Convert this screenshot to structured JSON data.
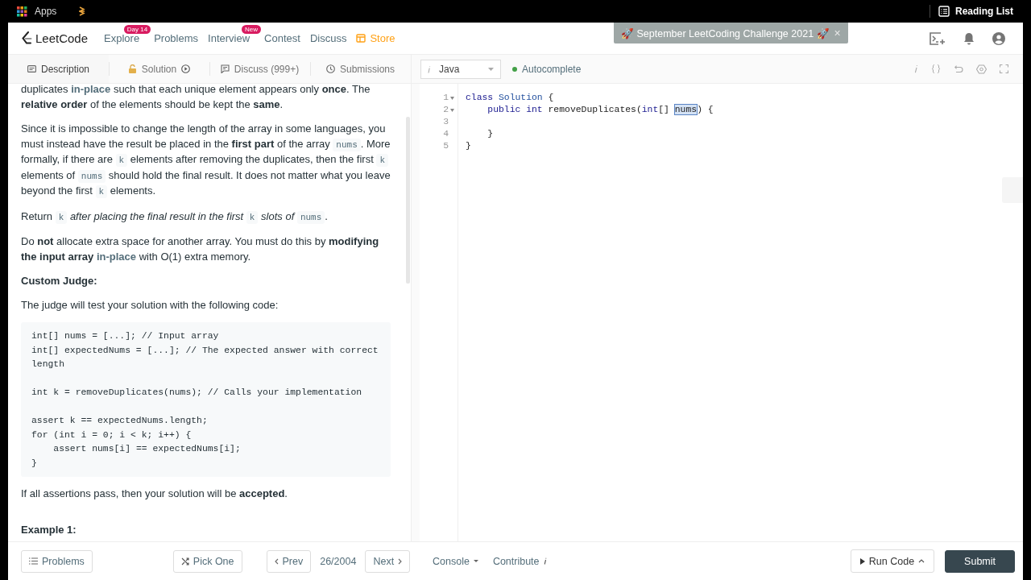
{
  "browser_bar": {
    "apps_label": "Apps",
    "reading_list": "Reading List"
  },
  "nav": {
    "logo": "LeetCode",
    "items": [
      {
        "label": "Explore",
        "badge": "Day 14",
        "kind": "link"
      },
      {
        "label": "Problems",
        "kind": "link"
      },
      {
        "label": "Interview",
        "badge": "New",
        "kind": "link"
      },
      {
        "label": "Contest",
        "kind": "link"
      },
      {
        "label": "Discuss",
        "kind": "link"
      },
      {
        "label": "Store",
        "kind": "store"
      }
    ]
  },
  "banner": {
    "text": "🚀 September LeetCoding Challenge 2021 🚀",
    "close": "×"
  },
  "panel_tabs": [
    {
      "label": "Description",
      "selected": true
    },
    {
      "label": "Solution",
      "selected": false
    },
    {
      "label": "Discuss (999+)",
      "selected": false
    },
    {
      "label": "Submissions",
      "selected": false
    }
  ],
  "editor_toolbar": {
    "language": "Java",
    "autocomplete": {
      "label": "Autocomplete",
      "on": true
    }
  },
  "description": {
    "blocks": [
      {
        "kind": "paragraph",
        "segments": [
          {
            "kind": "text",
            "text": "duplicates "
          },
          {
            "kind": "accent",
            "text": "in-place"
          },
          {
            "kind": "text",
            "text": " such that each unique element appears only **once**. The **relative order** of the elements should be kept the **same**."
          }
        ]
      },
      {
        "kind": "paragraph",
        "segments": [
          {
            "kind": "text",
            "text": "Since it is impossible to change the length of the array in some languages, you must instead have the result be placed in the **first part** of the array "
          },
          {
            "kind": "code",
            "text": "nums"
          },
          {
            "kind": "text",
            "text": ". More formally, if there are "
          },
          {
            "kind": "code",
            "text": "k"
          },
          {
            "kind": "text",
            "text": " elements after removing the duplicates, then the first "
          },
          {
            "kind": "code",
            "text": "k"
          },
          {
            "kind": "text",
            "text": " elements of "
          },
          {
            "kind": "code",
            "text": "nums"
          },
          {
            "kind": "text",
            "text": " should hold the final result. It does not matter what you leave beyond the first "
          },
          {
            "kind": "code",
            "text": "k"
          },
          {
            "kind": "text",
            "text": " elements."
          }
        ]
      },
      {
        "kind": "paragraph",
        "segments": [
          {
            "kind": "text",
            "text": "Return "
          },
          {
            "kind": "code",
            "text": "k"
          },
          {
            "kind": "text",
            "text": " *after placing the final result in the first* "
          },
          {
            "kind": "code",
            "text": "k"
          },
          {
            "kind": "text",
            "text": " *slots of* "
          },
          {
            "kind": "code",
            "text": "nums"
          },
          {
            "kind": "text",
            "text": "."
          }
        ]
      },
      {
        "kind": "paragraph",
        "segments": [
          {
            "kind": "text",
            "text": "Do **not** allocate extra space for another array. You must do this by **modifying the input array** "
          },
          {
            "kind": "accent",
            "text": "in-place"
          },
          {
            "kind": "text",
            "text": " with O(1) extra memory."
          }
        ]
      },
      {
        "kind": "heading",
        "text": "Custom Judge:"
      },
      {
        "kind": "paragraph",
        "segments": [
          {
            "kind": "text",
            "text": "The judge will test your solution with the following code:"
          }
        ]
      },
      {
        "kind": "code",
        "groups": [
          [
            "int[] nums = [...]; // Input array",
            "int[] expectedNums = [...]; // The expected answer with correct length"
          ],
          [
            "int k = removeDuplicates(nums); // Calls your implementation"
          ],
          [
            "assert k == expectedNums.length;",
            "for (int i = 0; i < k; i++) {",
            "    assert nums[i] == expectedNums[i];",
            "}"
          ]
        ]
      },
      {
        "kind": "paragraph",
        "segments": [
          {
            "kind": "text",
            "text": "If all assertions pass, then your solution will be **accepted**."
          }
        ]
      },
      {
        "kind": "heading",
        "text": "Example 1:"
      }
    ]
  },
  "editor": {
    "lines": [
      {
        "number": "1",
        "foldable": true,
        "segments": [
          {
            "kind": "keyword",
            "text": "class "
          },
          {
            "kind": "type",
            "text": "Solution"
          },
          {
            "kind": "plain",
            "text": " {"
          }
        ]
      },
      {
        "number": "2",
        "foldable": true,
        "segments": [
          {
            "kind": "keyword",
            "text": "    public int"
          },
          {
            "kind": "plain",
            "text": " removeDuplicates("
          },
          {
            "kind": "keyword",
            "text": "int"
          },
          {
            "kind": "plain",
            "text": "[] "
          },
          {
            "kind": "selected",
            "text": "nums"
          },
          {
            "kind": "plain",
            "text": ") {"
          }
        ]
      },
      {
        "number": "3",
        "foldable": false
      },
      {
        "number": "4",
        "foldable": false,
        "segments": [
          {
            "kind": "plain",
            "text": "    }"
          }
        ]
      },
      {
        "number": "5",
        "foldable": false,
        "segments": [
          {
            "kind": "plain",
            "text": "}"
          }
        ]
      }
    ]
  },
  "footer": {
    "problems": "Problems",
    "pick_one": "Pick One",
    "prev": "Prev",
    "counter": "26/2004",
    "next": "Next",
    "console": "Console",
    "contribute": "Contribute",
    "run_code": "Run Code",
    "submit": "Submit"
  }
}
